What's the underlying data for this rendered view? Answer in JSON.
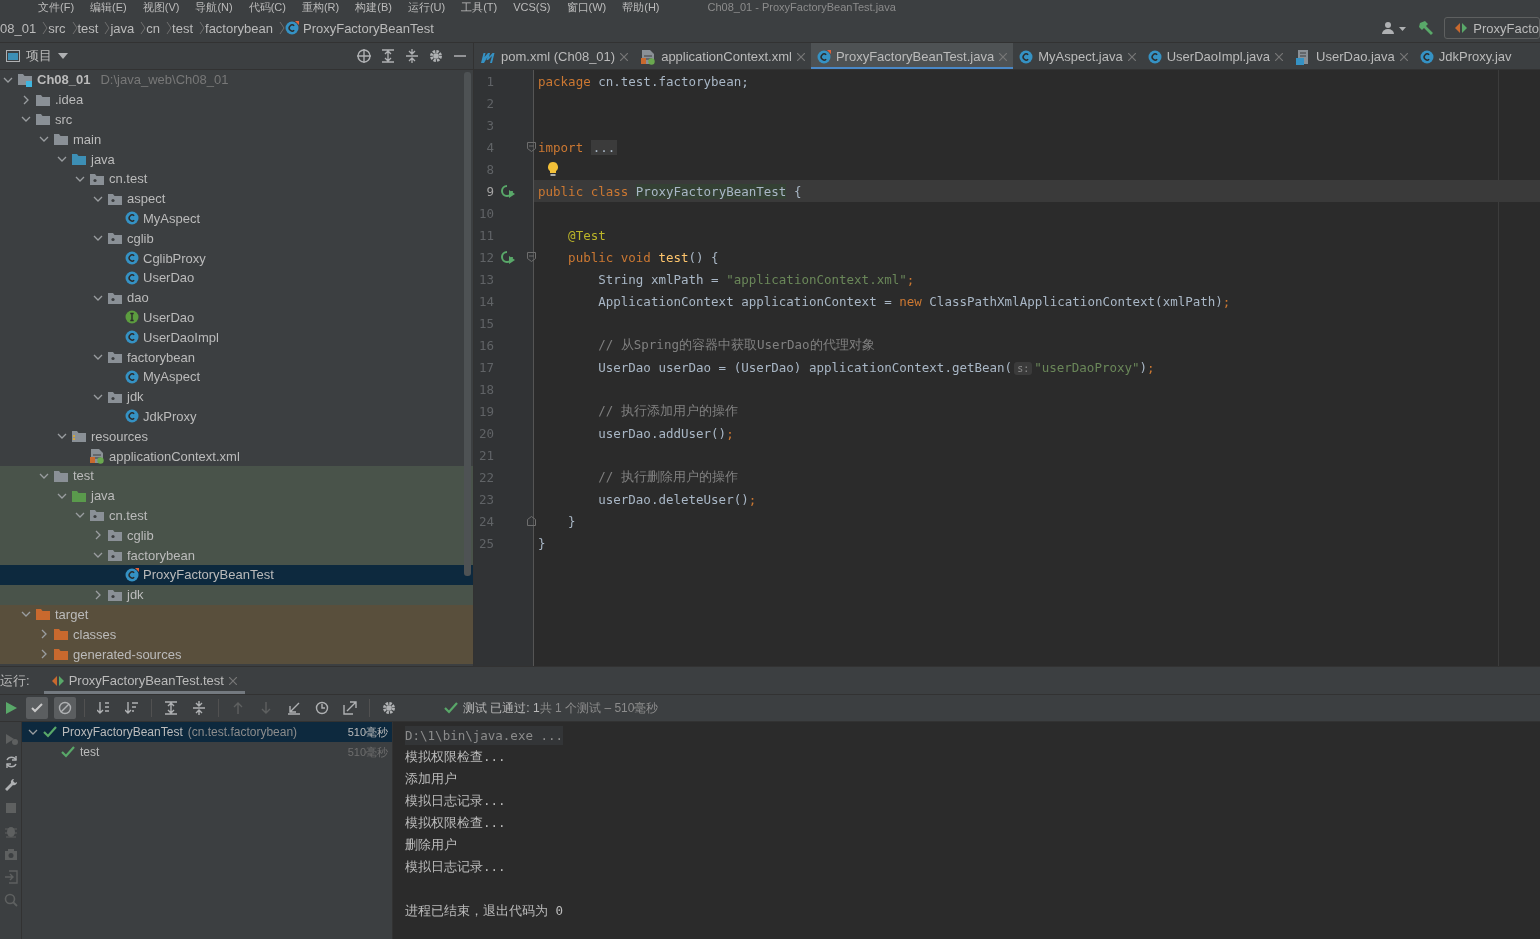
{
  "menu_bar": {
    "items": [
      "文件(F)",
      "编辑(E)",
      "视图(V)",
      "导航(N)",
      "代码(C)",
      "重构(R)",
      "构建(B)",
      "运行(U)",
      "工具(T)",
      "VCS(S)",
      "窗口(W)",
      "帮助(H)"
    ],
    "title": "Ch08_01 - ProxyFactoryBeanTest.java"
  },
  "breadcrumb": {
    "items": [
      {
        "label": "08_01",
        "kind": "plain"
      },
      {
        "label": "src",
        "kind": "plain"
      },
      {
        "label": "test",
        "kind": "plain"
      },
      {
        "label": "java",
        "kind": "plain"
      },
      {
        "label": "cn",
        "kind": "plain"
      },
      {
        "label": "test",
        "kind": "plain"
      },
      {
        "label": "factorybean",
        "kind": "plain"
      },
      {
        "label": "ProxyFactoryBeanTest",
        "kind": "test-class"
      }
    ],
    "run_config": "ProxyFacto"
  },
  "project_panel": {
    "title": "项目",
    "tree": [
      {
        "label": "Ch08_01",
        "path": "D:\\java_web\\Ch08_01",
        "kind": "module",
        "expanded": true,
        "selected": false,
        "children": [
          {
            "label": ".idea",
            "kind": "folder",
            "expanded": false,
            "selected": false
          },
          {
            "label": "src",
            "kind": "folder",
            "expanded": true,
            "selected": false,
            "children": [
              {
                "label": "main",
                "kind": "folder",
                "expanded": true,
                "selected": false,
                "children": [
                  {
                    "label": "java",
                    "kind": "source-root",
                    "expanded": true,
                    "selected": false,
                    "children": [
                      {
                        "label": "cn.test",
                        "kind": "package",
                        "expanded": true,
                        "selected": false,
                        "children": [
                          {
                            "label": "aspect",
                            "kind": "package",
                            "expanded": true,
                            "selected": false,
                            "children": [
                              {
                                "label": "MyAspect",
                                "kind": "class",
                                "selected": false
                              }
                            ]
                          },
                          {
                            "label": "cglib",
                            "kind": "package",
                            "expanded": true,
                            "selected": false,
                            "children": [
                              {
                                "label": "CglibProxy",
                                "kind": "class",
                                "selected": false
                              },
                              {
                                "label": "UserDao",
                                "kind": "class",
                                "selected": false
                              }
                            ]
                          },
                          {
                            "label": "dao",
                            "kind": "package",
                            "expanded": true,
                            "selected": false,
                            "children": [
                              {
                                "label": "UserDao",
                                "kind": "interface",
                                "selected": false
                              },
                              {
                                "label": "UserDaoImpl",
                                "kind": "class",
                                "selected": false
                              }
                            ]
                          },
                          {
                            "label": "factorybean",
                            "kind": "package",
                            "expanded": true,
                            "selected": false,
                            "children": [
                              {
                                "label": "MyAspect",
                                "kind": "class",
                                "selected": false
                              }
                            ]
                          },
                          {
                            "label": "jdk",
                            "kind": "package",
                            "expanded": true,
                            "selected": false,
                            "children": [
                              {
                                "label": "JdkProxy",
                                "kind": "class",
                                "selected": false
                              }
                            ]
                          }
                        ]
                      }
                    ]
                  },
                  {
                    "label": "resources",
                    "kind": "resources-root",
                    "expanded": true,
                    "selected": false,
                    "children": [
                      {
                        "label": "applicationContext.xml",
                        "kind": "xml",
                        "selected": false
                      }
                    ]
                  }
                ]
              },
              {
                "label": "test",
                "kind": "folder",
                "test_scope": true,
                "expanded": true,
                "selected": false,
                "children": [
                  {
                    "label": "java",
                    "kind": "test-root",
                    "expanded": true,
                    "selected": false,
                    "children": [
                      {
                        "label": "cn.test",
                        "kind": "package",
                        "expanded": true,
                        "selected": false,
                        "children": [
                          {
                            "label": "cglib",
                            "kind": "package",
                            "expanded": false,
                            "selected": false
                          },
                          {
                            "label": "factorybean",
                            "kind": "package",
                            "expanded": true,
                            "selected": false,
                            "children": [
                              {
                                "label": "ProxyFactoryBeanTest",
                                "kind": "test-class",
                                "selected": true
                              }
                            ]
                          },
                          {
                            "label": "jdk",
                            "kind": "package",
                            "expanded": false,
                            "selected": false
                          }
                        ]
                      }
                    ]
                  }
                ]
              }
            ]
          },
          {
            "label": "target",
            "kind": "excluded-folder",
            "excluded": true,
            "expanded": true,
            "selected": false,
            "children": [
              {
                "label": "classes",
                "kind": "excluded-folder",
                "expanded": false,
                "selected": false
              },
              {
                "label": "generated-sources",
                "kind": "excluded-folder",
                "expanded": false,
                "selected": false
              }
            ]
          }
        ]
      }
    ]
  },
  "editor": {
    "tabs": [
      {
        "label": "pom.xml (Ch08_01)",
        "kind": "maven",
        "selected": false
      },
      {
        "label": "applicationContext.xml",
        "kind": "xml",
        "selected": false
      },
      {
        "label": "ProxyFactoryBeanTest.java",
        "kind": "test-class",
        "selected": true
      },
      {
        "label": "MyAspect.java",
        "kind": "class",
        "selected": false
      },
      {
        "label": "UserDaoImpl.java",
        "kind": "class",
        "selected": false
      },
      {
        "label": "UserDao.java",
        "kind": "interface",
        "selected": false
      },
      {
        "label": "JdkProxy.jav",
        "kind": "class",
        "selected": false
      }
    ],
    "lines": [
      {
        "number": "1",
        "tokens": [
          {
            "kind": "keyword",
            "text": "package"
          },
          {
            "kind": "plain",
            "text": " cn.test.factorybean;"
          }
        ]
      },
      {
        "number": "2"
      },
      {
        "number": "3"
      },
      {
        "number": "4",
        "fold_start": true,
        "tokens": [
          {
            "kind": "keyword",
            "text": "import "
          },
          {
            "kind": "folded",
            "text": "..."
          }
        ]
      },
      {
        "number": "8",
        "bulb": true
      },
      {
        "number": "9",
        "run_icon": true,
        "current": true,
        "tokens": [
          {
            "kind": "keyword",
            "text": "public class "
          },
          {
            "kind": "highlight",
            "text": "ProxyFactoryBeanTest"
          },
          {
            "kind": "plain",
            "text": " {"
          }
        ]
      },
      {
        "number": "10"
      },
      {
        "number": "11",
        "tokens": [
          {
            "kind": "annotation",
            "text": "    @Test"
          }
        ]
      },
      {
        "number": "12",
        "run_icon": true,
        "fold_start": true,
        "tokens": [
          {
            "kind": "keyword",
            "text": "    public void "
          },
          {
            "kind": "method",
            "text": "test"
          },
          {
            "kind": "plain",
            "text": "() {"
          }
        ]
      },
      {
        "number": "13",
        "tokens": [
          {
            "kind": "plain",
            "text": "        String xmlPath = "
          },
          {
            "kind": "string",
            "text": "\"applicationContext.xml\""
          },
          {
            "kind": "keyword",
            "text": ";"
          }
        ]
      },
      {
        "number": "14",
        "tokens": [
          {
            "kind": "plain",
            "text": "        ApplicationContext applicationContext = "
          },
          {
            "kind": "keyword",
            "text": "new"
          },
          {
            "kind": "plain",
            "text": " ClassPathXmlApplicationContext(xmlPath)"
          },
          {
            "kind": "keyword",
            "text": ";"
          }
        ]
      },
      {
        "number": "15"
      },
      {
        "number": "16",
        "tokens": [
          {
            "kind": "comment",
            "text": "        // 从Spring的容器中获取UserDao的代理对象"
          }
        ]
      },
      {
        "number": "17",
        "tokens": [
          {
            "kind": "plain",
            "text": "        UserDao userDao = (UserDao) applicationContext.getBean("
          },
          {
            "kind": "hint",
            "text": "s:"
          },
          {
            "kind": "string",
            "text": "\"userDaoProxy\""
          },
          {
            "kind": "plain",
            "text": ")"
          },
          {
            "kind": "keyword",
            "text": ";"
          }
        ]
      },
      {
        "number": "18"
      },
      {
        "number": "19",
        "tokens": [
          {
            "kind": "comment",
            "text": "        // 执行添加用户的操作"
          }
        ]
      },
      {
        "number": "20",
        "tokens": [
          {
            "kind": "plain",
            "text": "        userDao.addUser()"
          },
          {
            "kind": "keyword",
            "text": ";"
          }
        ]
      },
      {
        "number": "21"
      },
      {
        "number": "22",
        "tokens": [
          {
            "kind": "comment",
            "text": "        // 执行删除用户的操作"
          }
        ]
      },
      {
        "number": "23",
        "tokens": [
          {
            "kind": "plain",
            "text": "        userDao.deleteUser()"
          },
          {
            "kind": "keyword",
            "text": ";"
          }
        ]
      },
      {
        "number": "24",
        "fold_end": true,
        "tokens": [
          {
            "kind": "plain",
            "text": "    }"
          }
        ]
      },
      {
        "number": "25",
        "tokens": [
          {
            "kind": "plain",
            "text": "}"
          }
        ]
      }
    ]
  },
  "run_panel": {
    "label": "运行:",
    "tab": "ProxyFactoryBeanTest.test",
    "status": {
      "passed": "测试 已通过: ",
      "count": "1",
      "detail": "共 1 个测试 – 510毫秒"
    },
    "tests": [
      {
        "name": "ProxyFactoryBeanTest",
        "package": "(cn.test.factorybean)",
        "time": "510毫秒",
        "passed": true,
        "selected": true,
        "children": [
          {
            "name": "test",
            "time": "510毫秒",
            "passed": true,
            "selected": false
          }
        ]
      }
    ],
    "console": [
      {
        "text": "D:\\1\\bin\\java.exe ...",
        "kind": "command"
      },
      {
        "text": "模拟权限检查...",
        "kind": "output"
      },
      {
        "text": "添加用户",
        "kind": "output"
      },
      {
        "text": "模拟日志记录...",
        "kind": "output"
      },
      {
        "text": "模拟权限检查...",
        "kind": "output"
      },
      {
        "text": "删除用户",
        "kind": "output"
      },
      {
        "text": "模拟日志记录...",
        "kind": "output"
      },
      {
        "kind": "blank"
      },
      {
        "text": "进程已结束，退出代码为 0",
        "kind": "output"
      }
    ]
  }
}
